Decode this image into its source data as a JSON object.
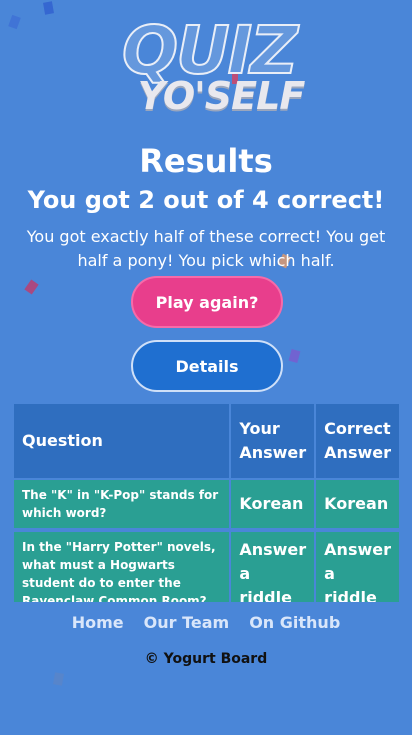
{
  "logo": {
    "line1": "QUIZ",
    "line2": "YO'SELF"
  },
  "results": {
    "title": "Results",
    "score_text": "You got 2 out of 4 correct!",
    "message": "You got exactly half of these correct! You get half a pony! You pick which half."
  },
  "buttons": {
    "play_again": "Play again?",
    "details": "Details"
  },
  "table": {
    "headers": {
      "question": "Question",
      "your_answer": "Your Answer",
      "correct_answer": "Correct Answer"
    },
    "rows": [
      {
        "question": "The \"K\" in \"K-Pop\" stands for which word?",
        "your_answer": "Korean",
        "correct_answer": "Korean"
      },
      {
        "question": "In the \"Harry Potter\" novels, what must a Hogwarts student do to enter the Ravenclaw Common Room?",
        "your_answer": "Answer a riddle",
        "correct_answer": "Answer a riddle"
      }
    ]
  },
  "footer": {
    "links": [
      "Home",
      "Our Team",
      "On Github"
    ],
    "copyright": "© Yogurt Board"
  },
  "colors": {
    "background": "#4a86d8",
    "play_button": "#e83e8c",
    "details_button": "#1f6fd0",
    "table_header": "#2f6ebf",
    "table_cell": "#2a9f93"
  }
}
